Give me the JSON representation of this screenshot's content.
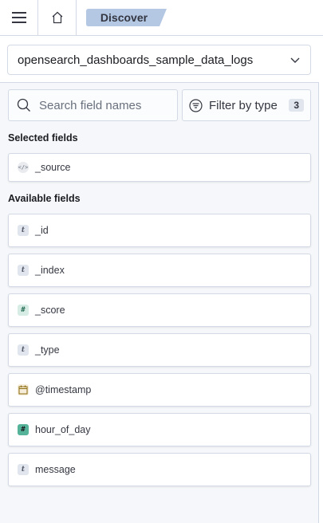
{
  "header": {
    "menu_icon": "hamburger-icon",
    "home_icon": "home-icon",
    "breadcrumb": "Discover",
    "breadcrumb_color": "#b4c8e4"
  },
  "index_pattern": {
    "value": "opensearch_dashboards_sample_data_logs",
    "icon": "chevron-down-icon"
  },
  "search": {
    "placeholder": "Search field names",
    "icon": "search-icon"
  },
  "filter": {
    "label": "Filter by type",
    "count": "3",
    "icon": "filter-icon"
  },
  "selected_fields": {
    "title": "Selected fields",
    "items": [
      {
        "name": "_source",
        "type": "source"
      }
    ]
  },
  "available_fields": {
    "title": "Available fields",
    "items": [
      {
        "name": "_id",
        "type": "string",
        "type_glyph": "t"
      },
      {
        "name": "_index",
        "type": "string",
        "type_glyph": "t"
      },
      {
        "name": "_score",
        "type": "number",
        "type_glyph": "#"
      },
      {
        "name": "_type",
        "type": "string",
        "type_glyph": "t"
      },
      {
        "name": "@timestamp",
        "type": "date"
      },
      {
        "name": "hour_of_day",
        "type": "number",
        "type_glyph": "#"
      },
      {
        "name": "message",
        "type": "string",
        "type_glyph": "t"
      }
    ]
  }
}
